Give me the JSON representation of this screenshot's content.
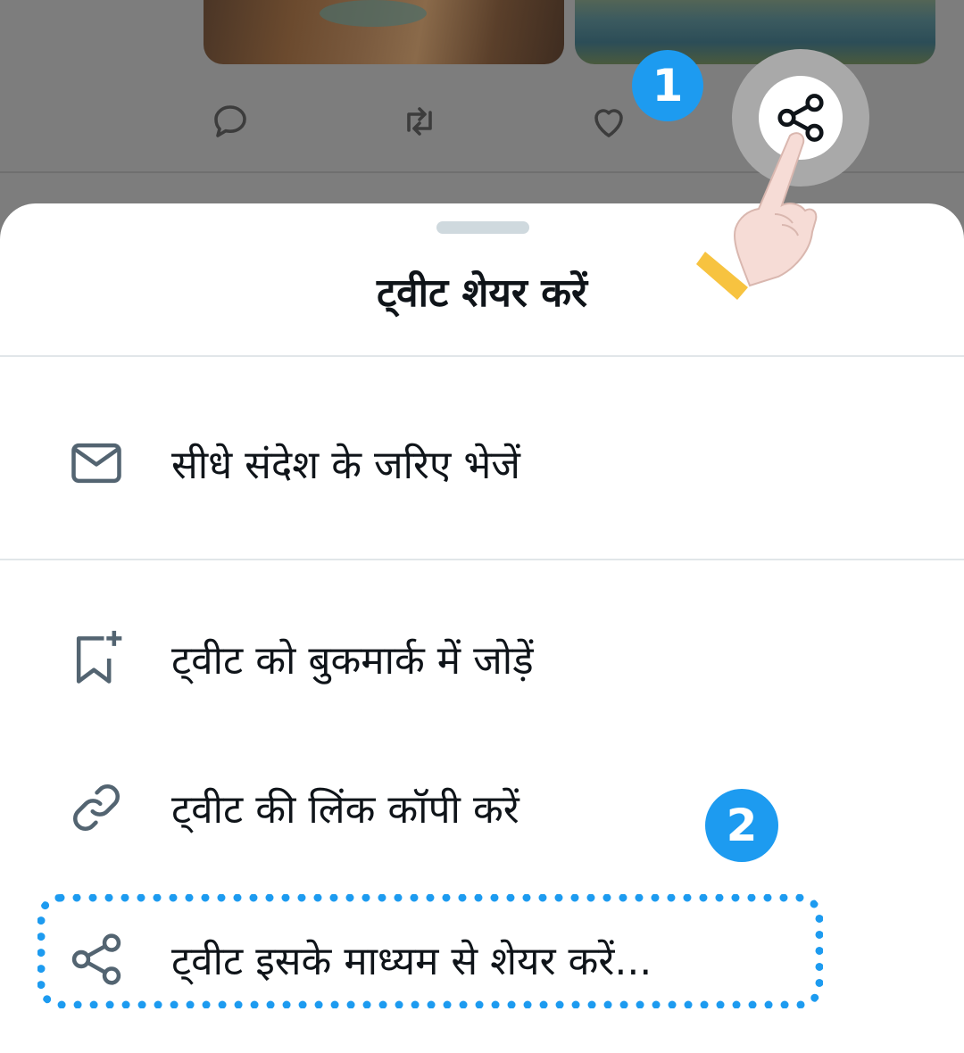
{
  "tweet": {
    "actions": [
      {
        "name": "reply",
        "icon": "reply-icon"
      },
      {
        "name": "retweet",
        "icon": "retweet-icon"
      },
      {
        "name": "like",
        "icon": "heart-icon"
      },
      {
        "name": "share",
        "icon": "share-icon"
      }
    ]
  },
  "badges": {
    "step1": "1",
    "step2": "2"
  },
  "sheet": {
    "title": "ट्वीट शेयर करें",
    "items": [
      {
        "label": "सीधे संदेश के जरिए भेजें",
        "icon": "mail-icon"
      },
      {
        "label": "ट्वीट को बुकमार्क में जोड़ें",
        "icon": "bookmark-add-icon"
      },
      {
        "label": "ट्वीट की लिंक कॉपी करें",
        "icon": "link-icon"
      },
      {
        "label": "ट्वीट इसके माध्यम से शेयर करें...",
        "icon": "share-icon"
      }
    ]
  },
  "colors": {
    "accent": "#1d9bf0",
    "text": "#0f1419",
    "icon": "#536471",
    "overlay": "#7d7d7d"
  }
}
